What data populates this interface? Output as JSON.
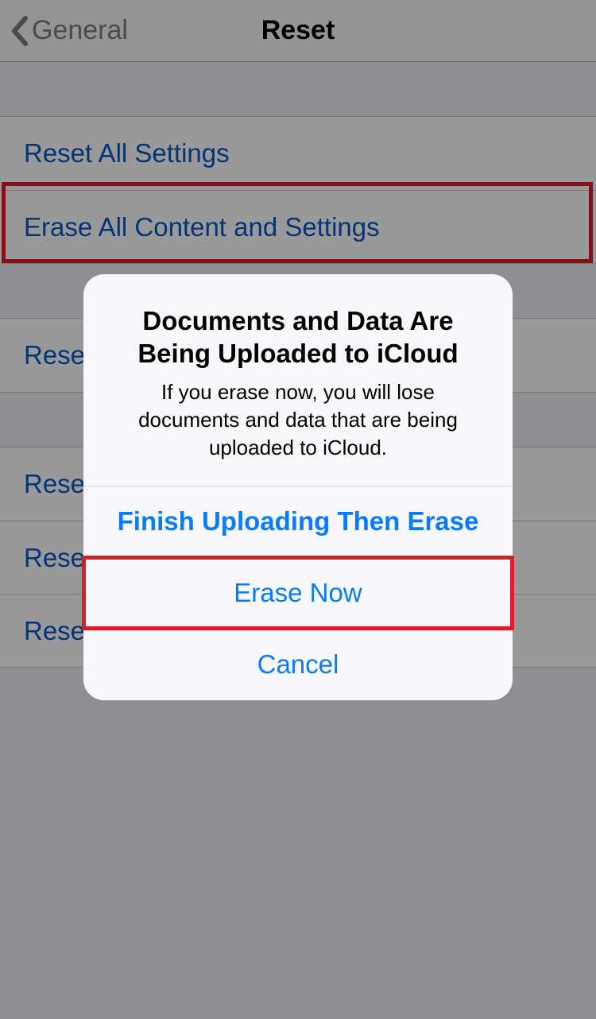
{
  "header": {
    "back_label": "General",
    "title": "Reset"
  },
  "groups": [
    {
      "items": [
        {
          "label": "Reset All Settings",
          "key": "reset-all-settings"
        },
        {
          "label": "Erase All Content and Settings",
          "key": "erase-all-content"
        }
      ]
    },
    {
      "items": [
        {
          "label": "Reset Network Settings",
          "key": "reset-network-settings"
        }
      ]
    },
    {
      "items": [
        {
          "label": "Reset Keyboard Dictionary",
          "key": "reset-keyboard-dictionary"
        },
        {
          "label": "Reset Home Screen Layout",
          "key": "reset-home-screen"
        },
        {
          "label": "Reset Location & Privacy",
          "key": "reset-location-privacy"
        }
      ]
    }
  ],
  "alert": {
    "title": "Documents and Data Are Being Uploaded to iCloud",
    "message": "If you erase now, you will lose documents and data that are being uploaded to iCloud.",
    "actions": {
      "finish": "Finish Uploading Then Erase",
      "erase": "Erase Now",
      "cancel": "Cancel"
    }
  }
}
